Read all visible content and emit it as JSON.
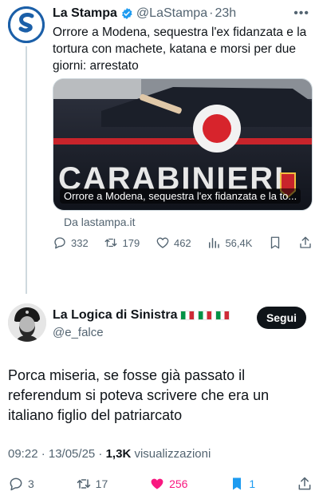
{
  "parent": {
    "name": "La Stampa",
    "handle": "@LaStampa",
    "separator": "·",
    "time": "23h",
    "text": "Orrore a Modena, sequestra l'ex fidanzata e la tortura con machete, katana e morsi per due giorni: arrestato",
    "card_caption": "Orrore a Modena, sequestra l'ex fidanzata e la to...",
    "card_image_text": "CARABINIERI",
    "card_source": "Da lastampa.it",
    "more_icon": "more-horizontal-icon",
    "actions": {
      "replies": "332",
      "reposts": "179",
      "likes": "462",
      "views": "56,4K"
    }
  },
  "reply": {
    "name": "La Logica di Sinistra",
    "handle": "@e_falce",
    "follow_label": "Segui",
    "text": "Porca miseria, se fosse già passato il referendum si poteva scrivere che era un italiano figlio del patriarcato",
    "timestamp": "09:22 · 13/05/25 · ",
    "views_count": "1,3K",
    "views_label": " visualizzazioni",
    "actions": {
      "replies": "3",
      "reposts": "17",
      "likes": "256",
      "bookmarks": "1"
    }
  },
  "colors": {
    "text": "#0f1419",
    "muted": "#536471",
    "like": "#f91880",
    "bookmark": "#1d9bf0",
    "verified": "#1d9bf0"
  }
}
